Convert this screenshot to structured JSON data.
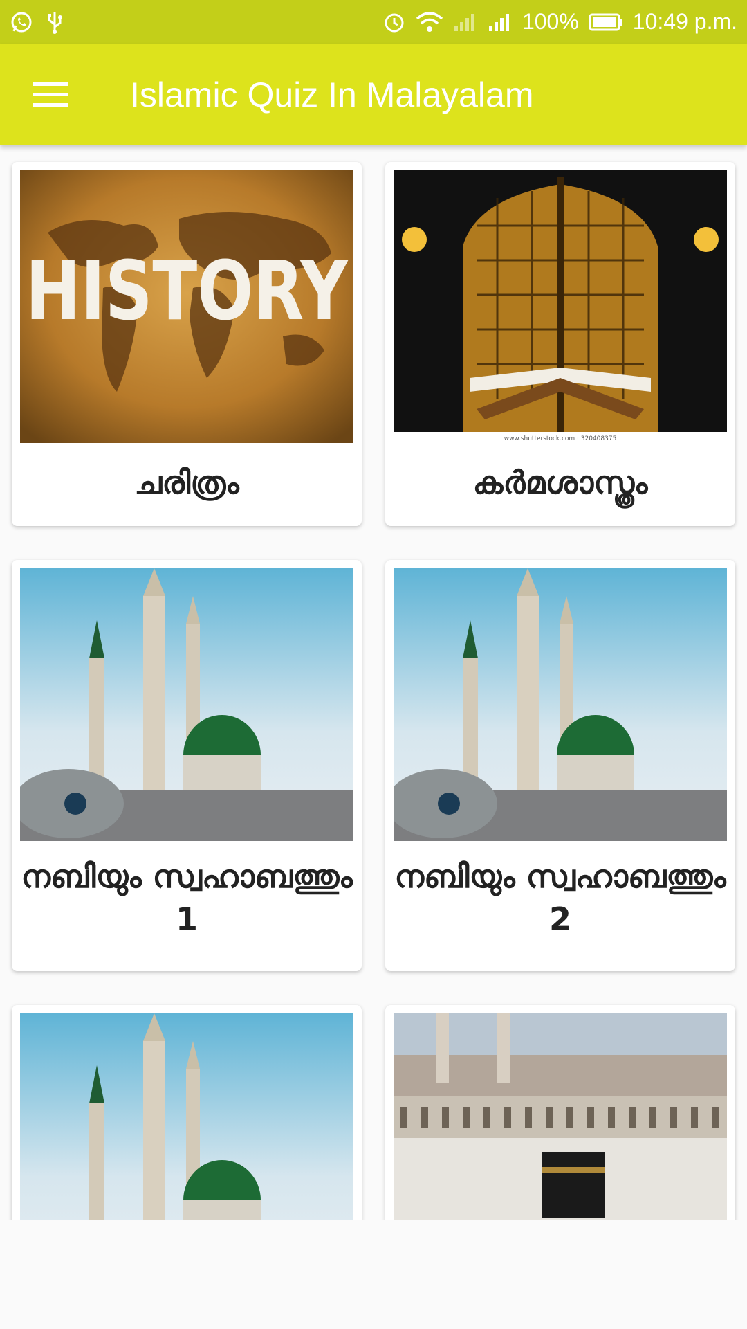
{
  "status_bar": {
    "battery": "100%",
    "time": "10:49 p.m.",
    "icons": [
      "whatsapp-icon",
      "usb-icon",
      "alarm-icon",
      "wifi-icon",
      "signal-off-icon",
      "signal-icon",
      "battery-icon"
    ]
  },
  "app_bar": {
    "title": "Islamic Quiz In Malayalam",
    "menu_icon": "hamburger-menu-icon",
    "color": "#dde31c"
  },
  "categories": [
    {
      "label": "ചരിത്രം",
      "image": "history-world-map"
    },
    {
      "label": "കർമശാസ്ത്രം",
      "image": "quran-on-rehal"
    },
    {
      "label": "നബിയും സ്വഹാബത്തും 1",
      "image": "green-dome-mosque"
    },
    {
      "label": "നബിയും സ്വഹാബത്തും 2",
      "image": "green-dome-mosque"
    },
    {
      "label": "",
      "image": "green-dome-mosque"
    },
    {
      "label": "",
      "image": "kaaba-mecca"
    }
  ],
  "colors": {
    "status_bar": "#c3cf19",
    "app_bar": "#dde31c",
    "background": "#fafafa"
  }
}
